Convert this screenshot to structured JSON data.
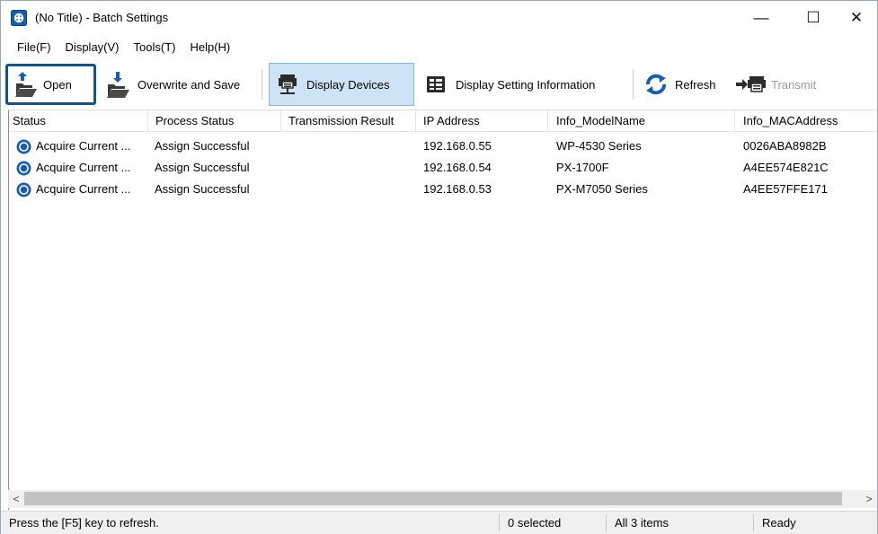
{
  "window": {
    "title": "(No Title) - Batch Settings",
    "controls": {
      "minimize": "—",
      "maximize": "☐",
      "close": "✕"
    }
  },
  "menu": {
    "items": [
      "File(F)",
      "Display(V)",
      "Tools(T)",
      "Help(H)"
    ]
  },
  "toolbar": {
    "open_label": "Open",
    "save_label": "Overwrite and Save",
    "display_devices_label": "Display Devices",
    "display_setting_label": "Display Setting Information",
    "refresh_label": "Refresh",
    "transmit_label": "Transmit",
    "accent": "#1f4f7f",
    "icon_blue": "#1a5ea8"
  },
  "table": {
    "columns": [
      "Status",
      "Process Status",
      "Transmission Result",
      "IP Address",
      "Info_ModelName",
      "Info_MACAddress"
    ],
    "rows": [
      {
        "status": "Acquire Current ...",
        "process": "Assign Successful",
        "transmission": "",
        "ip": "192.168.0.55",
        "model": "WP-4530 Series",
        "mac": "0026ABA8982B"
      },
      {
        "status": "Acquire Current ...",
        "process": "Assign Successful",
        "transmission": "",
        "ip": "192.168.0.54",
        "model": "PX-1700F",
        "mac": "A4EE574E821C"
      },
      {
        "status": "Acquire Current ...",
        "process": "Assign Successful",
        "transmission": "",
        "ip": "192.168.0.53",
        "model": "PX-M7050 Series",
        "mac": "A4EE57FFE171"
      }
    ]
  },
  "scrollbar": {
    "left_arrow": "<",
    "right_arrow": ">"
  },
  "statusbar": {
    "hint": "Press the [F5] key to refresh.",
    "selected": "0 selected",
    "count": "All 3 items",
    "state": "Ready"
  }
}
